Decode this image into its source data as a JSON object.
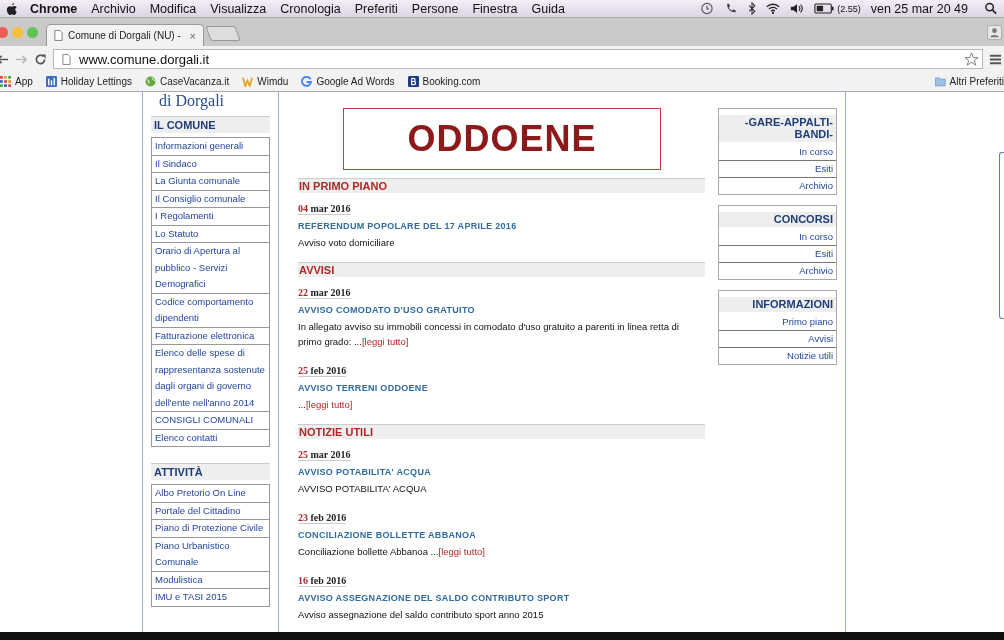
{
  "menubar": {
    "app": "Chrome",
    "items": [
      "Archivio",
      "Modifica",
      "Visualizza",
      "Cronologia",
      "Preferiti",
      "Persone",
      "Finestra",
      "Guida"
    ],
    "battery_reading": "(2.55)",
    "clock": "ven 25 mar  20 49"
  },
  "tab": {
    "title": "Comune di Dorgali (NU) -",
    "close": "×"
  },
  "address": {
    "url": "www.comune.dorgali.it"
  },
  "bookmarks": [
    {
      "label": "App",
      "kind": "apps"
    },
    {
      "label": "Holiday Lettings",
      "kind": "hl"
    },
    {
      "label": "CaseVacanza.it",
      "kind": "globe"
    },
    {
      "label": "Wimdu",
      "kind": "w"
    },
    {
      "label": "Google Ad Words",
      "kind": "g"
    },
    {
      "label": "Booking.com",
      "kind": "b"
    }
  ],
  "other_bookmarks": "Altri Preferiti",
  "site": {
    "logo_text": "di Dorgali",
    "left_sections": [
      {
        "title": "IL COMUNE",
        "items": [
          "Informazioni generali",
          "Il Sindaco",
          "La Giunta comunale",
          "Il Consiglio comunale",
          "I Regolamenti",
          "Lo Statuto",
          "Orario di Apertura al pubblico - Servizi Demografici",
          "Codice comportamento dipendenti",
          "Fatturazione elettronica",
          "Elenco delle spese di rappresentanza sostenute dagli organi di governo dell'ente nell'anno 2014",
          "CONSIGLI COMUNALI",
          "Elenco contatti"
        ]
      },
      {
        "title": "ATTIVITÀ",
        "items": [
          "Albo Pretorio On Line",
          "Portale del Cittadino",
          "Piano di Protezione Civile",
          "Piano Urbanistico Comunale",
          "Modulistica",
          "IMU e TASI 2015"
        ]
      }
    ],
    "banner": "ODDOENE",
    "news_sections": [
      {
        "title": "IN PRIMO PIANO",
        "entries": [
          {
            "day": "04",
            "month_year": "mar 2016",
            "title": "REFERENDUM POPOLARE DEL 17 APRILE 2016",
            "excerpt": "Avviso voto domiciliare"
          }
        ]
      },
      {
        "title": "AVVISI",
        "entries": [
          {
            "day": "22",
            "month_year": "mar 2016",
            "title": "AVVISO COMODATO D'USO GRATUITO",
            "excerpt": "In allegato avviso su immobili concessi in comodato d'uso gratuito a parenti in linea retta di primo grado: ...",
            "read_more": "[leggi tutto]"
          },
          {
            "day": "25",
            "month_year": "feb 2016",
            "title": "AVVISO TERRENI ODDOENE",
            "excerpt": "...",
            "read_more": "[leggi tutto]"
          }
        ]
      },
      {
        "title": "NOTIZIE UTILI",
        "entries": [
          {
            "day": "25",
            "month_year": "mar 2016",
            "title": "AVVISO POTABILITA' ACQUA",
            "excerpt": "AVVISO POTABILITA' ACQUA"
          },
          {
            "day": "23",
            "month_year": "feb 2016",
            "title": "CONCILIAZIONE BOLLETTE ABBANOA",
            "excerpt": "Conciliazione bollette Abbanoa ...",
            "read_more": "[leggi tutto]"
          },
          {
            "day": "16",
            "month_year": "feb 2016",
            "title": "AVVISO ASSEGNAZIONE DEL SALDO CONTRIBUTO SPORT",
            "excerpt": "Avviso assegnazione del saldo contributo sport anno 2015"
          }
        ]
      }
    ],
    "right_boxes": [
      {
        "title": "-GARE-APPALTI-BANDI-",
        "items": [
          "In corso",
          "Esiti",
          "Archivio"
        ]
      },
      {
        "title": "CONCORSI",
        "items": [
          "In corso",
          "Esiti",
          "Archivio"
        ]
      },
      {
        "title": "INFORMAZIONI",
        "items": [
          "Primo piano",
          "Avvisi",
          "Notizie utili"
        ]
      }
    ]
  }
}
